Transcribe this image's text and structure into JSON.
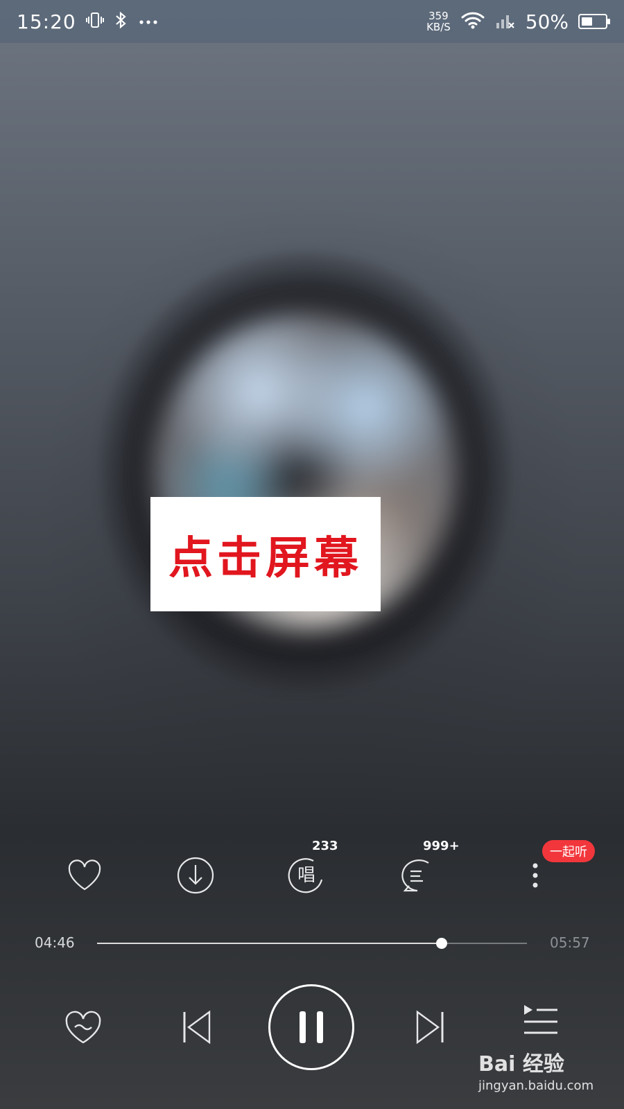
{
  "status_bar": {
    "time": "15:20",
    "net_speed_value": "359",
    "net_speed_unit": "KB/S",
    "battery_percent": "50%",
    "battery_level": 0.5,
    "icons": [
      "vibrate-icon",
      "bluetooth-icon",
      "more-notifications-icon",
      "wifi-icon",
      "signal-icon",
      "battery-icon"
    ]
  },
  "overlay": {
    "label": "点击屏幕"
  },
  "actions": {
    "sing_count": "233",
    "comment_count": "999+",
    "listen_together_label": "一起听",
    "icons": [
      "heart-icon",
      "download-icon",
      "sing-icon",
      "comment-icon",
      "more-vertical-icon"
    ]
  },
  "progress": {
    "current_time": "04:46",
    "total_time": "05:57",
    "fraction": 0.801
  },
  "controls": {
    "icons": [
      "heart-mode-icon",
      "previous-icon",
      "pause-icon",
      "next-icon",
      "playlist-icon"
    ]
  },
  "watermark": {
    "brand": "Bai 经验",
    "url": "jingyan.baidu.com"
  },
  "colors": {
    "accent_red": "#f2373c",
    "overlay_text": "#e1161e"
  }
}
